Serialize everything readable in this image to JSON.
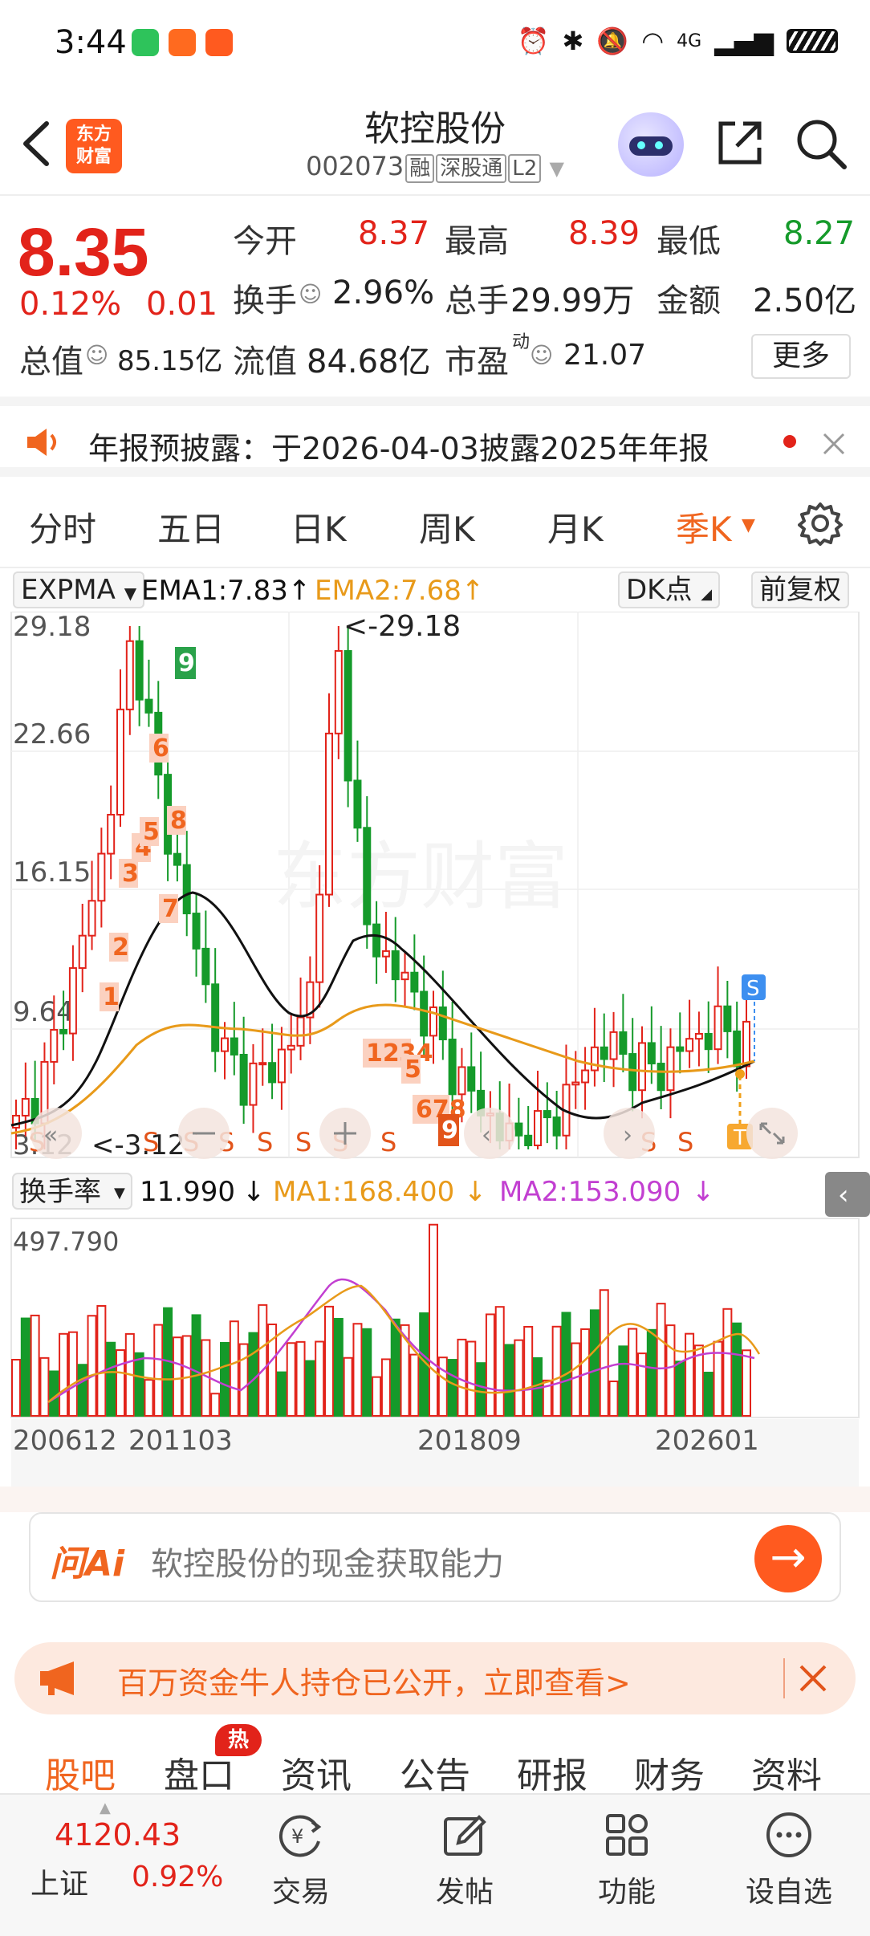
{
  "status_bar": {
    "time": "3:44",
    "network": "4G"
  },
  "header": {
    "logo_text": "东方财富",
    "stock_name": "软控股份",
    "stock_code": "002073",
    "tags": [
      "融",
      "深股通",
      "L2"
    ]
  },
  "quote": {
    "price": "8.35",
    "change_pct": "0.12%",
    "change_abs": "0.01",
    "open_label": "今开",
    "open_value": "8.37",
    "high_label": "最高",
    "high_value": "8.39",
    "low_label": "最低",
    "low_value": "8.27",
    "turnover_label": "换手",
    "turnover_value": "2.96%",
    "volume_label": "总手",
    "volume_value": "29.99万",
    "amount_label": "金额",
    "amount_value": "2.50亿",
    "total_cap_label": "总值",
    "total_cap_value": "85.15亿",
    "float_cap_label": "流值",
    "float_cap_value": "84.68亿",
    "pe_label": "市盈",
    "pe_sup": "动",
    "pe_value": "21.07",
    "more_label": "更多"
  },
  "notice": {
    "text": "年报预披露：于2026-04-03披露2025年年报"
  },
  "period_tabs": [
    "分时",
    "五日",
    "日K",
    "周K",
    "月K",
    "季K"
  ],
  "active_period": "季K",
  "indicator": {
    "name": "EXPMA",
    "ema1": "EMA1:7.83",
    "ema2": "EMA2:7.68",
    "dk_label": "DK点",
    "adjust_label": "前复权"
  },
  "price_chart": {
    "y_labels": [
      "29.18",
      "22.66",
      "16.15",
      "9.64",
      "3.12"
    ],
    "max_annotation": "<-29.18",
    "min_annotation": "<-3.12",
    "watermark": "东方财富",
    "signals_s": [
      "S",
      "S",
      "S",
      "S",
      "S",
      "S",
      "S",
      "S",
      "S",
      "S"
    ],
    "signal_b": "S",
    "t_marker": "T"
  },
  "volume_chart": {
    "indicator_name": "换手率",
    "value": "11.990",
    "ma1": "MA1:168.400",
    "ma2": "MA2:153.090",
    "top_label": "497.790",
    "x_labels": [
      "200612",
      "201103",
      "201809",
      "202601"
    ]
  },
  "chart_data": {
    "type": "candlestick",
    "period": "quarterly",
    "y_range": [
      3.12,
      29.18
    ],
    "approx_close_path": [
      4.2,
      6.8,
      12,
      18,
      29,
      20,
      14,
      8,
      6.5,
      7.5,
      10,
      28,
      14,
      12,
      10,
      7,
      5,
      3.5,
      4,
      6,
      8.5,
      7.5,
      7,
      8.5,
      9.2,
      8.35
    ]
  },
  "ai": {
    "logo": "问Ai",
    "placeholder": "软控股份的现金获取能力",
    "go": "→"
  },
  "promo": {
    "text": "百万资金牛人持仓已公开，立即查看>"
  },
  "bottom_tabs": [
    "股吧",
    "盘口",
    "资讯",
    "公告",
    "研报",
    "财务",
    "资料"
  ],
  "hot_badge": "热",
  "index": {
    "value": "4120.43",
    "name": "上证",
    "pct": "0.92%"
  },
  "nav": {
    "trade": "交易",
    "post": "发帖",
    "func": "功能",
    "watch": "设自选"
  },
  "colors": {
    "up": "#e2231a",
    "down": "#159a2a",
    "accent": "#f0651f",
    "ema1": "#111111",
    "ema2": "#e89a1a",
    "ma2": "#c23fd1"
  }
}
